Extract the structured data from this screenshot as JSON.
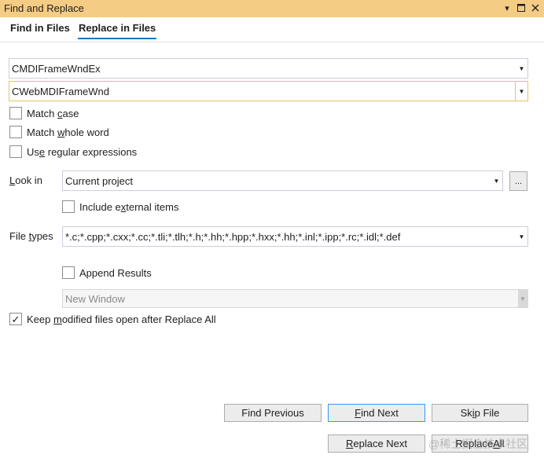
{
  "window": {
    "title": "Find and Replace",
    "pin_icon": "pin-icon",
    "maximize_icon": "maximize-icon",
    "close_icon": "close-icon"
  },
  "tabs": [
    {
      "label": "Find in Files",
      "active": false
    },
    {
      "label": "Replace in Files",
      "active": true
    }
  ],
  "find": {
    "value": "CMDIFrameWndEx"
  },
  "replace": {
    "value": "CWebMDIFrameWnd"
  },
  "options": {
    "match_case": {
      "pre": "Match ",
      "key": "c",
      "post": "ase",
      "checked": false
    },
    "match_whole_word": {
      "pre": "Match ",
      "key": "w",
      "post": "hole word",
      "checked": false
    },
    "use_regex": {
      "pre": "Us",
      "key": "e",
      "post": " regular expressions",
      "checked": false
    }
  },
  "look_in": {
    "label_key": "L",
    "label_rest": "ook in",
    "value": "Current project",
    "browse_label": "..."
  },
  "include_external": {
    "pre": "Include e",
    "key": "x",
    "post": "ternal items",
    "checked": false
  },
  "file_types": {
    "label_pre": "File ",
    "label_key": "t",
    "label_post": "ypes",
    "value": "*.c;*.cpp;*.cxx;*.cc;*.tli;*.tlh;*.h;*.hh;*.hpp;*.hxx;*.hh;*.inl;*.ipp;*.rc;*.idl;*.def"
  },
  "append_results": {
    "label": "Append Results",
    "checked": false
  },
  "result_window": {
    "value": "New Window"
  },
  "keep_open": {
    "pre": "Keep ",
    "key": "m",
    "post": "odified files open after Replace All",
    "checked": true,
    "check_glyph": "✓"
  },
  "buttons": {
    "find_previous": "Find Previous",
    "find_next": {
      "key": "F",
      "rest": "ind Next"
    },
    "skip_file": {
      "pre": "Sk",
      "key": "i",
      "post": "p File"
    },
    "replace_next": {
      "key": "R",
      "rest": "eplace Next"
    },
    "replace_all": {
      "pre": "Replace ",
      "key": "A",
      "post": "ll"
    }
  },
  "watermark": "@稀土掘金技术社区"
}
